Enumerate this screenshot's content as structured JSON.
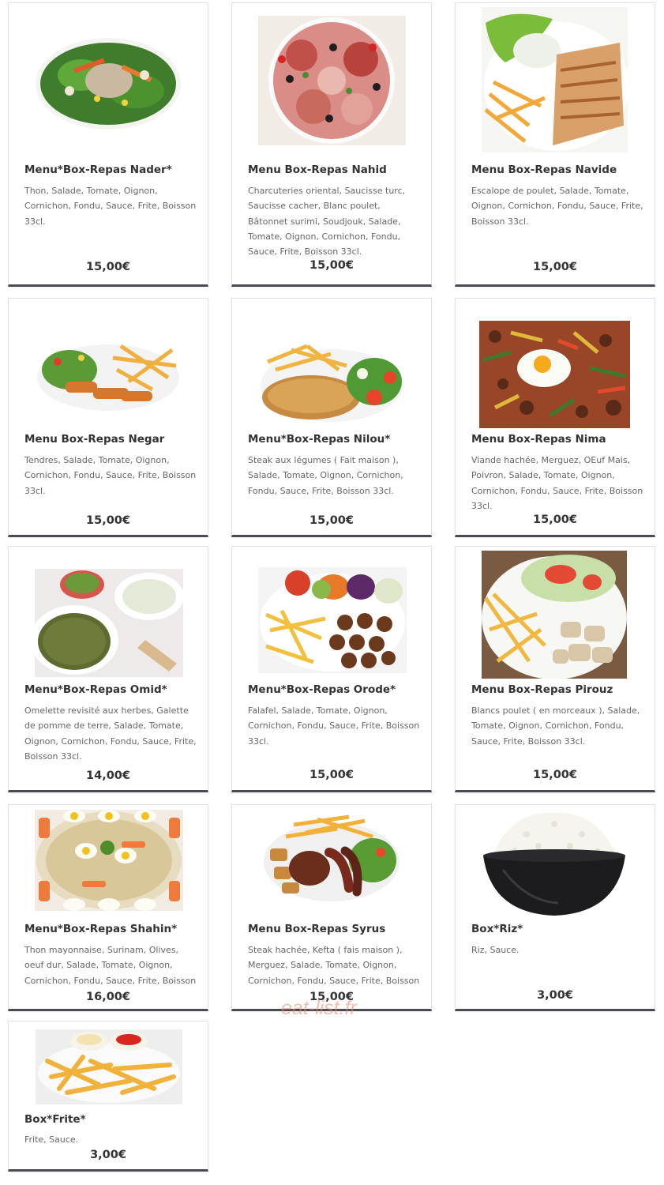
{
  "items": [
    {
      "title": "Menu*Box-Repas Nader*",
      "description": "Thon, Salade, Tomate, Oignon, Cornichon, Fondu, Sauce, Frite, Boisson 33cl.",
      "price": "15,00€",
      "image": "tuna-salad-photo"
    },
    {
      "title": "Menu Box-Repas Nahid",
      "description": "Charcuteries oriental, Saucisse turc, Saucisse cacher, Blanc poulet, Bâtonnet surimi, Soudjouk, Salade, Tomate, Oignon, Cornichon, Fondu, Sauce, Frite, Boisson 33cl.",
      "price": "15,00€",
      "image": "charcuterie-platter-photo"
    },
    {
      "title": "Menu Box-Repas Navide",
      "description": "Escalope de poulet, Salade, Tomate, Oignon, Cornichon, Fondu, Sauce, Frite, Boisson 33cl.",
      "price": "15,00€",
      "image": "chicken-escalope-photo"
    },
    {
      "title": "Menu Box-Repas Negar",
      "description": "Tendres, Salade, Tomate, Oignon, Cornichon, Fondu, Sauce, Frite, Boisson 33cl.",
      "price": "15,00€",
      "image": "chicken-tenders-photo"
    },
    {
      "title": "Menu*Box-Repas Nilou*",
      "description": "Steak aux légumes ( Fait maison ), Salade, Tomate, Oignon, Cornichon, Fondu, Sauce, Frite, Boisson 33cl.",
      "price": "15,00€",
      "image": "breaded-steak-photo"
    },
    {
      "title": "Menu Box-Repas Nima",
      "description": "Viande hachée, Merguez, OEuf Mais, Poivron, Salade, Tomate, Oignon, Cornichon, Fondu, Sauce, Frite, Boisson 33cl.",
      "price": "15,00€",
      "image": "egg-pizza-photo"
    },
    {
      "title": "Menu*Box-Repas Omid*",
      "description": "Omelette revisité aux herbes, Galette de pomme de terre, Salade, Tomate, Oignon, Cornichon, Fondu, Sauce, Frite, Boisson 33cl.",
      "price": "14,00€",
      "image": "herb-omelette-photo"
    },
    {
      "title": "Menu*Box-Repas Orode*",
      "description": "Falafel, Salade, Tomate, Oignon, Cornichon, Fondu, Sauce, Frite, Boisson 33cl.",
      "price": "15,00€",
      "image": "falafel-plate-photo"
    },
    {
      "title": "Menu Box-Repas Pirouz",
      "description": "Blancs poulet ( en morceaux ), Salade, Tomate, Oignon, Cornichon, Fondu, Sauce, Frite, Boisson 33cl.",
      "price": "15,00€",
      "image": "chicken-pieces-photo"
    },
    {
      "title": "Menu*Box-Repas Shahin*",
      "description": "Thon mayonnaise, Surinam, Olives, oeuf dur, Salade, Tomate, Oignon, Cornichon, Fondu, Sauce, Frite, Boisson",
      "price": "16,00€",
      "image": "egg-surimi-salad-photo"
    },
    {
      "title": "Menu Box-Repas Syrus",
      "description": "Steak hachée, Kefta ( fais maison ), Merguez, Salade, Tomate, Oignon, Cornichon, Fondu, Sauce, Frite, Boisson",
      "price": "15,00€",
      "image": "mixed-grill-photo"
    },
    {
      "title": "Box*Riz*",
      "description": "Riz, Sauce.",
      "price": "3,00€",
      "image": "rice-bowl-photo"
    },
    {
      "title": "Box*Frite*",
      "description": "Frite, Sauce.",
      "price": "3,00€",
      "image": "fries-plate-photo"
    }
  ],
  "watermark": "eat-list.fr",
  "colors": {
    "title": "#333333",
    "description": "#666666",
    "card_border_bottom": "#4a4a52",
    "watermark": "#e88a6e"
  }
}
